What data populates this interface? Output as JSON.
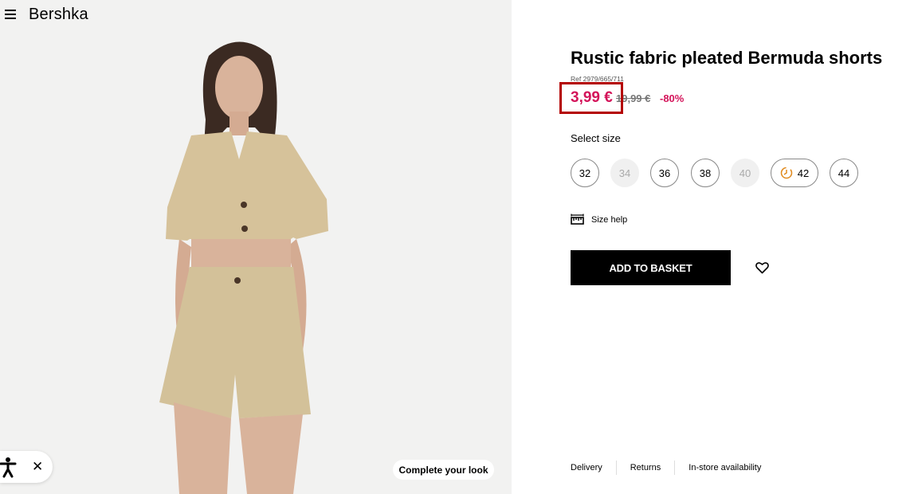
{
  "header": {
    "brand": "Bershka"
  },
  "product": {
    "title": "Rustic fabric pleated Bermuda shorts",
    "ref": "Ref 2979/665/711",
    "price": "3,99 €",
    "old_price": "19,99 €",
    "discount": "-80%"
  },
  "sizes": {
    "label": "Select size",
    "items": [
      {
        "label": "32",
        "available": true
      },
      {
        "label": "34",
        "available": false
      },
      {
        "label": "36",
        "available": true
      },
      {
        "label": "38",
        "available": true
      },
      {
        "label": "40",
        "available": false
      },
      {
        "label": "42",
        "available": true,
        "icon": "clock-icon"
      },
      {
        "label": "44",
        "available": true
      }
    ]
  },
  "size_help": "Size help",
  "add_to_basket": "ADD TO BASKET",
  "complete_look": "Complete your look",
  "footer": {
    "links": [
      "Delivery",
      "Returns",
      "In-store availability"
    ]
  },
  "colors": {
    "sale": "#d4145a",
    "highlight_box": "#b40000",
    "button": "#000000"
  }
}
